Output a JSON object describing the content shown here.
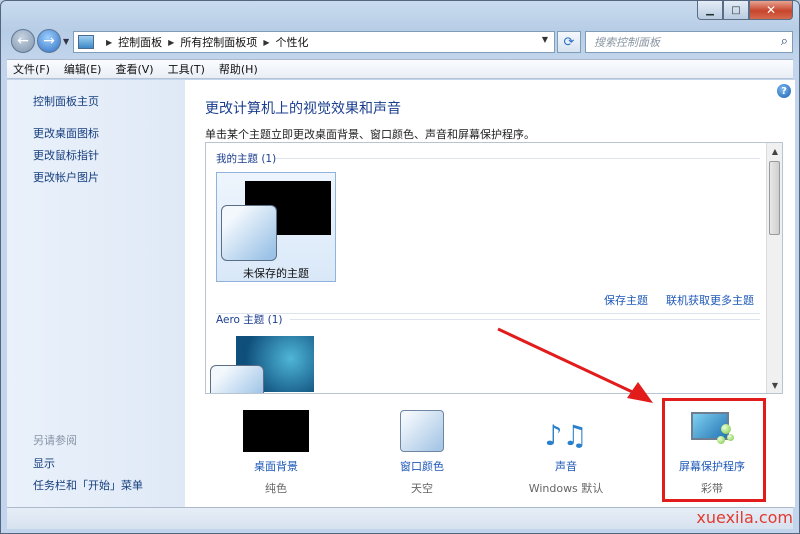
{
  "address": {
    "crumbs": [
      "控制面板",
      "所有控制面板项",
      "个性化"
    ]
  },
  "search": {
    "placeholder": "搜索控制面板"
  },
  "menu": [
    "文件(F)",
    "编辑(E)",
    "查看(V)",
    "工具(T)",
    "帮助(H)"
  ],
  "sidebar": {
    "home": "控制面板主页",
    "links": [
      "更改桌面图标",
      "更改鼠标指针",
      "更改帐户图片"
    ],
    "see_also_header": "另请参阅",
    "see_also": [
      "显示",
      "任务栏和「开始」菜单"
    ]
  },
  "main": {
    "title": "更改计算机上的视觉效果和声音",
    "description": "单击某个主题立即更改桌面背景、窗口颜色、声音和屏幕保护程序。",
    "my_themes_header": "我的主题 (1)",
    "unsaved_theme_label": "未保存的主题",
    "save_theme_link": "保存主题",
    "more_themes_link": "联机获取更多主题",
    "aero_header": "Aero 主题 (1)"
  },
  "settings": [
    {
      "label": "桌面背景",
      "value": "纯色",
      "icon": "desktop-background-icon"
    },
    {
      "label": "窗口颜色",
      "value": "天空",
      "icon": "window-color-icon"
    },
    {
      "label": "声音",
      "value": "Windows 默认",
      "icon": "sound-icon"
    },
    {
      "label": "屏幕保护程序",
      "value": "彩带",
      "icon": "screensaver-icon"
    }
  ],
  "colors": {
    "highlight": "#e21b1b",
    "link": "#1e58b8",
    "title": "#1b3e8f"
  },
  "watermark": "xuexila.com"
}
